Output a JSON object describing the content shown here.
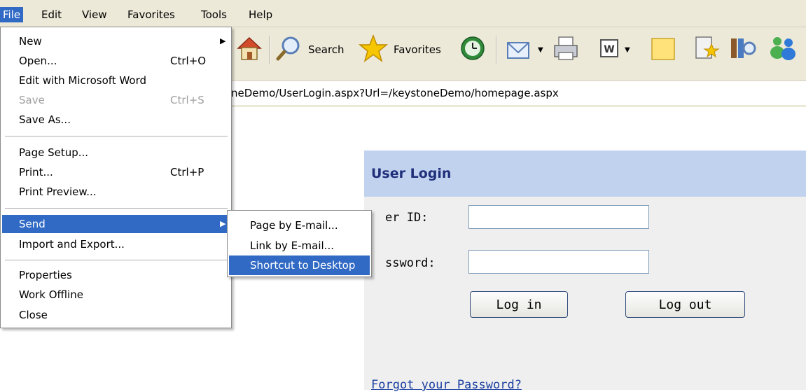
{
  "menubar": {
    "items": [
      {
        "label": "File",
        "active": true
      },
      {
        "label": "Edit"
      },
      {
        "label": "View"
      },
      {
        "label": "Favorites"
      },
      {
        "label": "Tools"
      },
      {
        "label": "Help"
      }
    ]
  },
  "toolbar": {
    "search_label": "Search",
    "favorites_label": "Favorites",
    "icons": [
      "home-icon",
      "search-icon",
      "favorites-star-icon",
      "history-icon",
      "mail-icon",
      "print-icon",
      "word-edit-icon",
      "sticky-note-icon",
      "research-icon",
      "media-icon",
      "messenger-icon"
    ]
  },
  "address": {
    "url": "neDemo/UserLogin.aspx?Url=/keystoneDemo/homepage.aspx"
  },
  "file_menu": {
    "items": [
      {
        "label": "New",
        "shortcut": "",
        "submenu": true
      },
      {
        "label": "Open...",
        "shortcut": "Ctrl+O"
      },
      {
        "label": "Edit with Microsoft Word",
        "shortcut": ""
      },
      {
        "label": "Save",
        "shortcut": "Ctrl+S",
        "disabled": true
      },
      {
        "label": "Save As...",
        "shortcut": ""
      },
      {
        "label": "Page Setup...",
        "shortcut": ""
      },
      {
        "label": "Print...",
        "shortcut": "Ctrl+P"
      },
      {
        "label": "Print Preview...",
        "shortcut": ""
      },
      {
        "label": "Send",
        "shortcut": "",
        "submenu": true,
        "active": true
      },
      {
        "label": "Import and Export...",
        "shortcut": ""
      },
      {
        "label": "Properties",
        "shortcut": ""
      },
      {
        "label": "Work Offline",
        "shortcut": ""
      },
      {
        "label": "Close",
        "shortcut": ""
      }
    ]
  },
  "send_submenu": {
    "items": [
      {
        "label": "Page by E-mail..."
      },
      {
        "label": "Link by E-mail..."
      },
      {
        "label": "Shortcut to Desktop",
        "active": true
      }
    ]
  },
  "login": {
    "title": "User Login",
    "user_id_label": "er ID:",
    "password_label": "ssword:",
    "user_id_value": "",
    "password_value": "",
    "login_button": "Log in",
    "logout_button": "Log out",
    "forgot_link": "Forgot your Password?"
  },
  "colors": {
    "menu_highlight": "#316ac5",
    "login_header": "#c1d2ef",
    "login_title": "#1f2f7a",
    "link": "#1a3fa0"
  }
}
